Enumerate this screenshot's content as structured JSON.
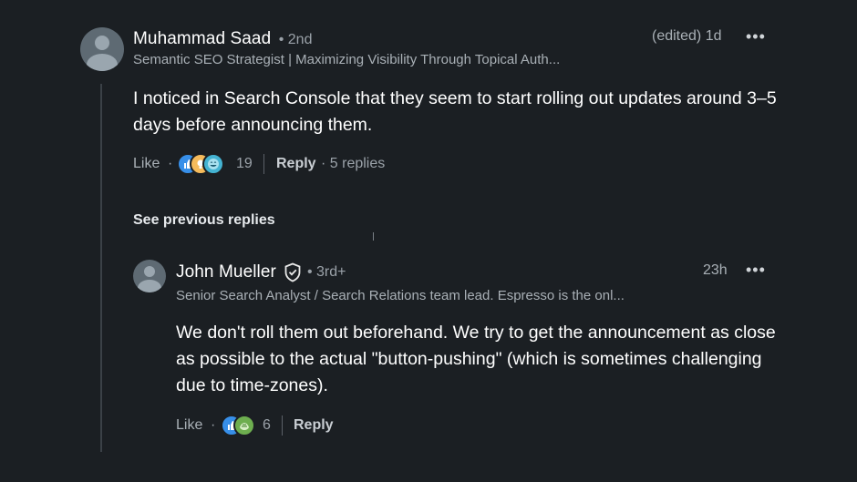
{
  "comment": {
    "author": "Muhammad Saad",
    "degree": "• 2nd",
    "headline": "Semantic SEO Strategist | Maximizing Visibility Through Topical Auth...",
    "time": "(edited) 1d",
    "text": "I noticed in Search Console that they seem to start rolling out updates around 3–5 days before announcing them.",
    "like_label": "Like",
    "reaction_count": "19",
    "reply_label": "Reply",
    "replies_count": "· 5 replies",
    "reaction_icons": [
      "like-icon",
      "insightful-icon",
      "funny-icon"
    ],
    "colors": {
      "like": "#378fe9",
      "insightful": "#f5bb5c",
      "funny": "#44b3d2"
    }
  },
  "see_previous_label": "See previous replies",
  "reply": {
    "author": "John Mueller",
    "degree": "• 3rd+",
    "headline": "Senior Search Analyst / Search Relations team lead. Espresso is the onl...",
    "time": "23h",
    "text": "We don't roll them out beforehand. We try to get the announcement as close as possible to the actual \"button-pushing\" (which is sometimes challenging due to time-zones).",
    "like_label": "Like",
    "reaction_count": "6",
    "reply_label": "Reply",
    "reaction_icons": [
      "like-icon",
      "support-icon"
    ],
    "colors": {
      "like": "#378fe9",
      "support": "#6dae4f"
    }
  }
}
